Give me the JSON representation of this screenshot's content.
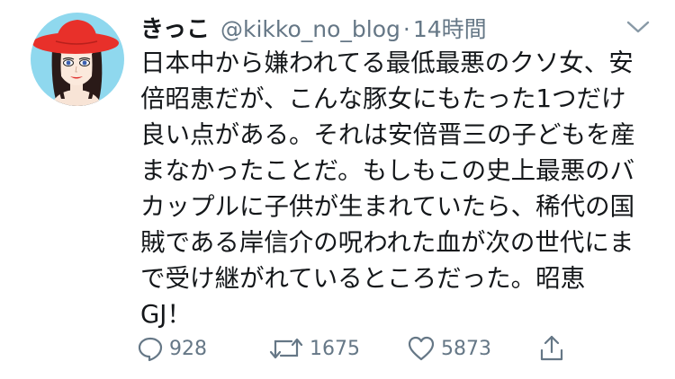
{
  "tweet": {
    "display_name": "きっこ",
    "handle": "@kikko_no_blog",
    "separator": "·",
    "time": "14時間",
    "text_lines": [
      "日本中から嫌われてる最低最悪のクソ女、安",
      "倍昭恵だが、こんな豚女にもたった1つだけ",
      "良い点がある。それは安倍晋三の子どもを産",
      "まなかったことだ。もしもこの史上最悪のバ",
      "カップルに子供が生まれていたら、稀代の国",
      "賊である岸信介の呪われた血が次の世代にま",
      "で受け継がれているところだった。昭恵",
      "GJ！"
    ],
    "actions": {
      "reply_count": "928",
      "retweet_count": "1675",
      "like_count": "5873"
    }
  },
  "icons": {
    "avatar": "avatar",
    "caret": "chevron-down-icon",
    "reply": "reply-icon",
    "retweet": "retweet-icon",
    "like": "heart-icon",
    "share": "share-icon"
  },
  "colors": {
    "text": "#14171a",
    "secondary": "#657786",
    "avatar_background": "#8fd8ee",
    "hat": "#e8302a"
  }
}
